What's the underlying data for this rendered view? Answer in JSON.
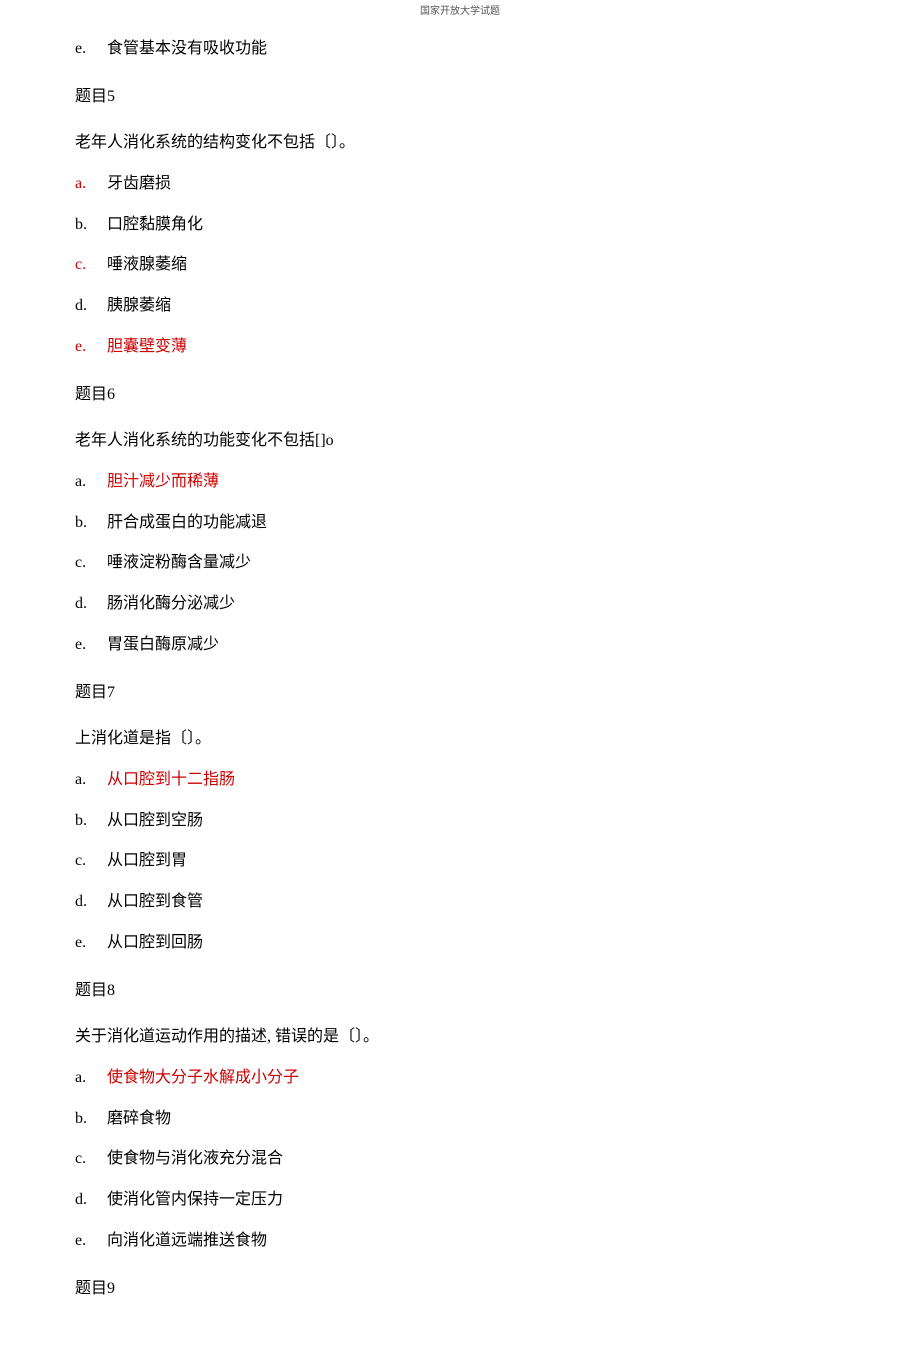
{
  "header": "国家开放大学试题",
  "pre_option": {
    "letter": "e.",
    "text": "食管基本没有吸收功能",
    "letter_color": "black",
    "text_color": "black"
  },
  "questions": [
    {
      "heading": "题目5",
      "stem": "老年人消化系统的结构变化不包括〔〕。",
      "options": [
        {
          "letter": "a.",
          "text": "牙齿磨损",
          "letter_color": "red",
          "text_color": "black"
        },
        {
          "letter": "b.",
          "text": "口腔黏膜角化",
          "letter_color": "black",
          "text_color": "black"
        },
        {
          "letter": "c.",
          "text": "唾液腺萎缩",
          "letter_color": "red",
          "text_color": "black"
        },
        {
          "letter": "d.",
          "text": "胰腺萎缩",
          "letter_color": "black",
          "text_color": "black"
        },
        {
          "letter": "e.",
          "text": "胆囊壁变薄",
          "letter_color": "red",
          "text_color": "red"
        }
      ]
    },
    {
      "heading": "题目6",
      "stem": "老年人消化系统的功能变化不包括[]o",
      "options": [
        {
          "letter": "a.",
          "text": "胆汁减少而稀薄",
          "letter_color": "black",
          "text_color": "red"
        },
        {
          "letter": "b.",
          "text": "肝合成蛋白的功能减退",
          "letter_color": "black",
          "text_color": "black"
        },
        {
          "letter": "c.",
          "text": "唾液淀粉酶含量减少",
          "letter_color": "black",
          "text_color": "black"
        },
        {
          "letter": "d.",
          "text": "肠消化酶分泌减少",
          "letter_color": "black",
          "text_color": "black"
        },
        {
          "letter": "e.",
          "text": "胃蛋白酶原减少",
          "letter_color": "black",
          "text_color": "black"
        }
      ]
    },
    {
      "heading": "题目7",
      "stem": "上消化道是指〔〕。",
      "options": [
        {
          "letter": "a.",
          "text": "从口腔到十二指肠",
          "letter_color": "black",
          "text_color": "red"
        },
        {
          "letter": "b.",
          "text": "从口腔到空肠",
          "letter_color": "black",
          "text_color": "black"
        },
        {
          "letter": "c.",
          "text": "从口腔到胃",
          "letter_color": "black",
          "text_color": "black"
        },
        {
          "letter": "d.",
          "text": "从口腔到食管",
          "letter_color": "black",
          "text_color": "black"
        },
        {
          "letter": "e.",
          "text": "从口腔到回肠",
          "letter_color": "black",
          "text_color": "black"
        }
      ]
    },
    {
      "heading": "题目8",
      "stem": "关于消化道运动作用的描述, 错误的是〔〕。",
      "options": [
        {
          "letter": "a.",
          "text": "使食物大分子水解成小分子",
          "letter_color": "black",
          "text_color": "red"
        },
        {
          "letter": "b.",
          "text": "磨碎食物",
          "letter_color": "black",
          "text_color": "black"
        },
        {
          "letter": "c.",
          "text": "使食物与消化液充分混合",
          "letter_color": "black",
          "text_color": "black"
        },
        {
          "letter": "d.",
          "text": "使消化管内保持一定压力",
          "letter_color": "black",
          "text_color": "black"
        },
        {
          "letter": "e.",
          "text": "向消化道远端推送食物",
          "letter_color": "black",
          "text_color": "black"
        }
      ]
    },
    {
      "heading": "题目9",
      "stem": "",
      "options": []
    }
  ]
}
